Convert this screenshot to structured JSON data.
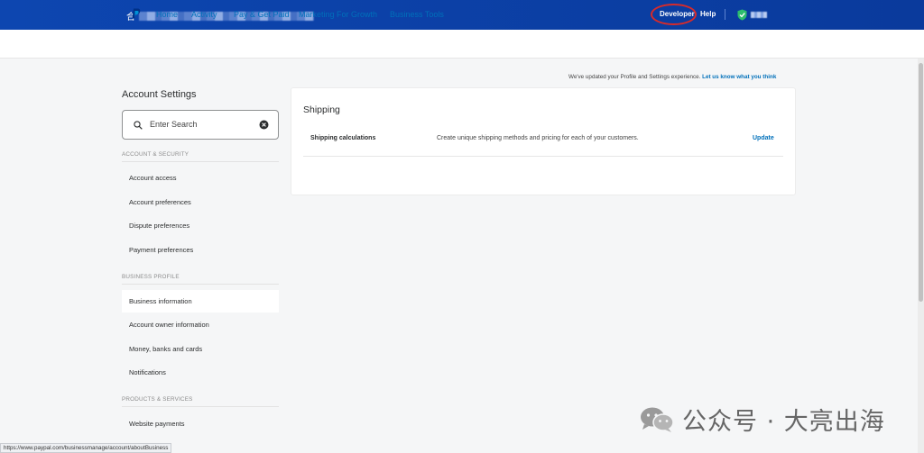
{
  "topbar": {
    "account_char": "合",
    "developer": "Developer",
    "help": "Help"
  },
  "nav": {
    "items": [
      "Home",
      "Activity",
      "Pay & Get Paid",
      "Marketing For Growth",
      "Business Tools"
    ]
  },
  "notice": {
    "text": "We've updated your Profile and Settings experience. ",
    "link": "Let us know what you think"
  },
  "sidebar": {
    "title": "Account Settings",
    "search_placeholder": "Enter Search",
    "sections": [
      {
        "header": "ACCOUNT & SECURITY",
        "items": [
          "Account access",
          "Account preferences",
          "Dispute preferences",
          "Payment preferences"
        ]
      },
      {
        "header": "BUSINESS PROFILE",
        "items": [
          "Business information",
          "Account owner information",
          "Money, banks and cards",
          "Notifications"
        ]
      },
      {
        "header": "PRODUCTS & SERVICES",
        "items": [
          "Website payments"
        ]
      }
    ],
    "active_item": "Business information"
  },
  "main": {
    "title": "Shipping",
    "row": {
      "label": "Shipping calculations",
      "description": "Create unique shipping methods and pricing for each of your customers.",
      "action": "Update"
    }
  },
  "status_url": "https://www.paypal.com/businessmanage/account/aboutBusiness",
  "watermark": "公众号 · 大亮出海",
  "colors": {
    "topbar": "#0a3d9e",
    "link": "#0070ba",
    "highlight_circle": "#d62b2b"
  }
}
